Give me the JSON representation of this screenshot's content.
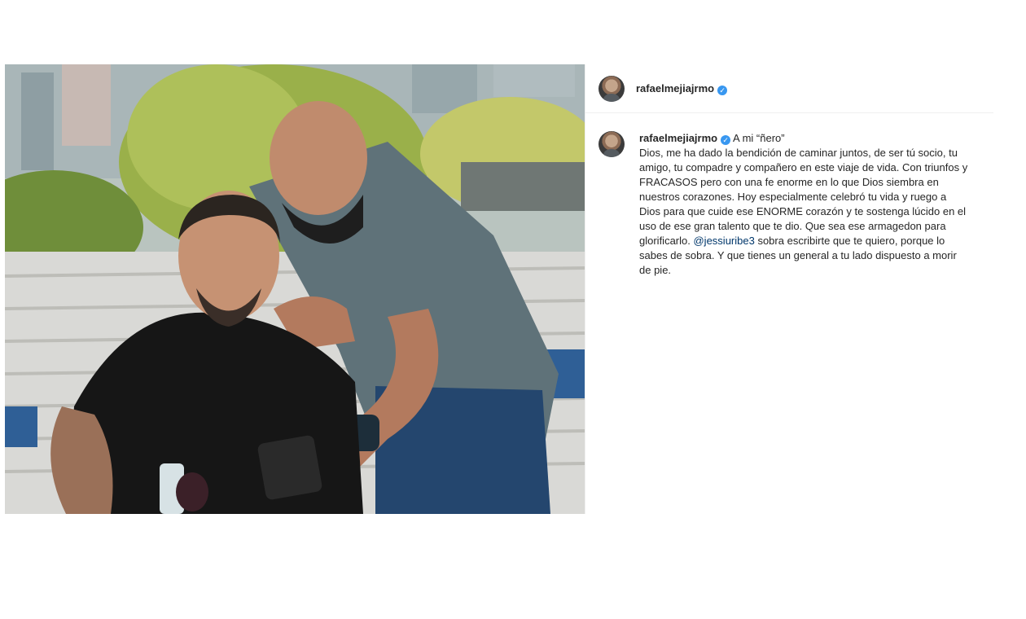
{
  "post": {
    "author": {
      "username": "rafaelmejiajrmo",
      "verified_icon": "verified-badge-icon"
    },
    "photo_alt": "Dos hombres mirando un teléfono celular",
    "caption": {
      "username": "rafaelmejiajrmo",
      "title": "A mi “ñero”",
      "text_before_mention": "Dios, me ha dado la bendición de caminar juntos, de ser tú socio, tu amigo, tu compadre y compañero en este viaje de vida. Con triunfos y FRACASOS pero con una fe enorme en lo que Dios siembra en nuestros corazones. Hoy especialmente celebró tu vida y ruego a Dios para que cuide ese ENORME corazón y te sostenga lúcido en el uso de ese gran talento que te dio. Que sea ese armagedon para glorificarlo.",
      "mention": "@jessiuribe3",
      "text_after_mention": "sobra escribirte que te quiero, porque lo sabes de sobra. Y que tienes un general a tu lado dispuesto a morir de pie."
    },
    "colors": {
      "verified": "#3897f0",
      "mention": "#00376b",
      "text": "#262626",
      "divider": "#efefef"
    }
  }
}
